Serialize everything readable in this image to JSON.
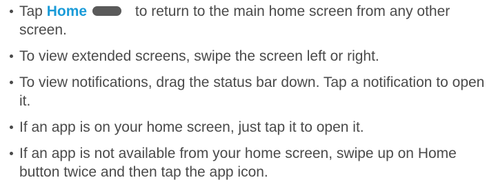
{
  "bullets": [
    {
      "pre": "Tap ",
      "highlight": "Home",
      "icon": "home-button-pill-icon",
      "post": " to return to the main home screen from any other screen."
    },
    {
      "text": "To view extended screens, swipe the screen left or right."
    },
    {
      "text": "To view notifications, drag the status bar down. Tap a notification to open it."
    },
    {
      "text": "If an app is on your home screen, just tap it to open it."
    },
    {
      "text": "If an app is not available from your home screen, swipe up on Home button twice and then tap the app icon."
    }
  ],
  "colors": {
    "body_text": "#4a4a4a",
    "highlight": "#1a9bd8",
    "icon_fill": "#5a5a5a"
  }
}
